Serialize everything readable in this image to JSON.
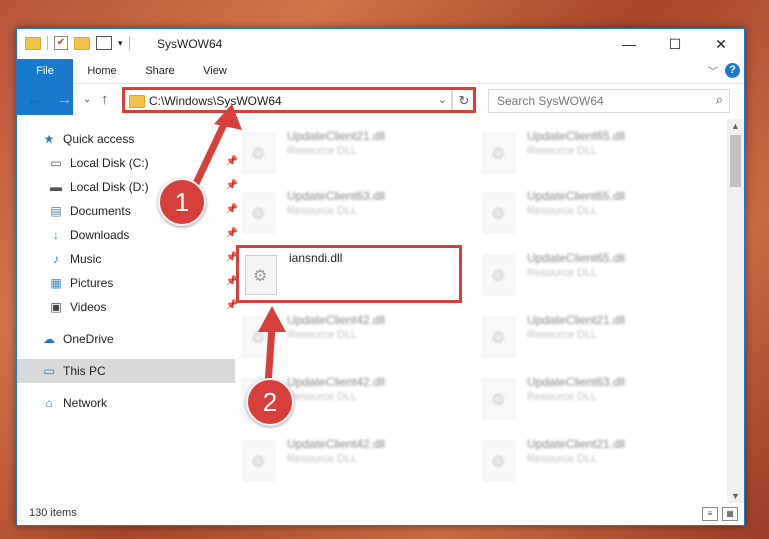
{
  "window": {
    "title": "SysWOW64",
    "controls": {
      "minimize": "—",
      "maximize": "☐",
      "close": "✕"
    }
  },
  "ribbon": {
    "tabs": [
      "File",
      "Home",
      "Share",
      "View"
    ],
    "collapse": "﹀",
    "help": "?"
  },
  "address": {
    "path": "C:\\Windows\\SysWOW64",
    "dropdown": "⌄",
    "refresh": "↻"
  },
  "search": {
    "placeholder": "Search SysWOW64",
    "icon": "⌕"
  },
  "nav": {
    "back": "←",
    "forward": "→",
    "recent": "⌄",
    "up": "↑",
    "items": [
      {
        "label": "Quick access",
        "icon": "★"
      },
      {
        "label": "Local Disk (C:)",
        "icon": "▭"
      },
      {
        "label": "Local Disk (D:)",
        "icon": "▬"
      },
      {
        "label": "Documents",
        "icon": "▤"
      },
      {
        "label": "Downloads",
        "icon": "↓"
      },
      {
        "label": "Music",
        "icon": "♪"
      },
      {
        "label": "Pictures",
        "icon": "▦"
      },
      {
        "label": "Videos",
        "icon": "▣"
      },
      {
        "label": "OneDrive",
        "icon": "☁"
      },
      {
        "label": "This PC",
        "icon": "▭"
      },
      {
        "label": "Network",
        "icon": "⌂"
      }
    ],
    "pin": "📌"
  },
  "files": [
    {
      "name": "UpdateClient21.dll",
      "type": "Resource DLL"
    },
    {
      "name": "UpdateClient65.dll",
      "type": "Resource DLL"
    },
    {
      "name": "UpdateClient63.dll",
      "type": "Resource DLL"
    },
    {
      "name": "UpdateClient65.dll",
      "type": "Resource DLL"
    },
    {
      "name": "iansndi.dll",
      "type": ""
    },
    {
      "name": "UpdateClient65.dll",
      "type": "Resource DLL"
    },
    {
      "name": "UpdateClient42.dll",
      "type": "Resource DLL"
    },
    {
      "name": "UpdateClient21.dll",
      "type": "Resource DLL"
    },
    {
      "name": "UpdateClient42.dll",
      "type": "Resource DLL"
    },
    {
      "name": "UpdateClient63.dll",
      "type": "Resource DLL"
    },
    {
      "name": "UpdateClient42.dll",
      "type": "Resource DLL"
    },
    {
      "name": "UpdateClient21.dll",
      "type": "Resource DLL"
    }
  ],
  "status": {
    "count": "130 items"
  },
  "annotations": {
    "step1": "1",
    "step2": "2",
    "color": "#d7403a"
  }
}
